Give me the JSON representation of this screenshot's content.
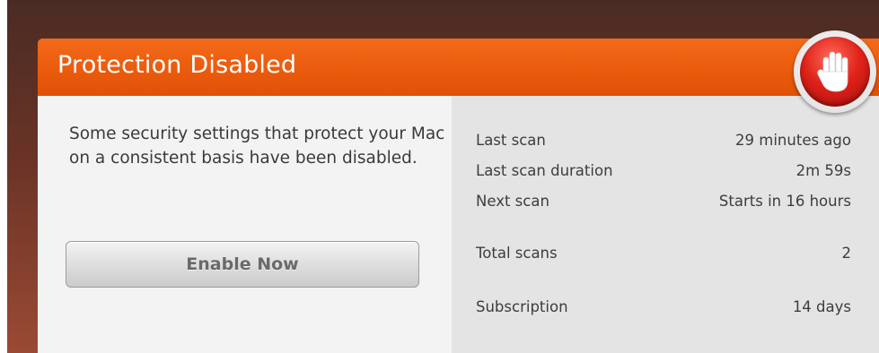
{
  "header": {
    "title": "Protection Disabled"
  },
  "message": "Some security settings that protect your Mac on a consistent basis have been disabled.",
  "enable_button": {
    "label": "Enable Now"
  },
  "stats": [
    {
      "label": "Last scan",
      "value": "29 minutes ago"
    },
    {
      "label": "Last scan duration",
      "value": "2m 59s"
    },
    {
      "label": "Next scan",
      "value": "Starts in 16 hours"
    },
    {
      "label": "Total scans",
      "value": "2"
    },
    {
      "label": "Subscription",
      "value": "14 days"
    }
  ],
  "status_icon": "stop-hand-icon",
  "colors": {
    "header": "#ea5a0c",
    "badge": "#e0231a",
    "backdrop": "#6a3326"
  }
}
